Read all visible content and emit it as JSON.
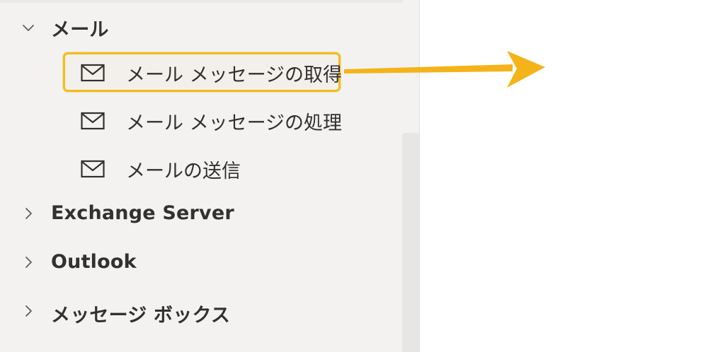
{
  "tree": {
    "group_mail": {
      "label": "メール",
      "expanded": true,
      "icon": "chevron-down-icon"
    },
    "mail_items": [
      {
        "label": "メール メッセージの取得",
        "icon": "mail-icon",
        "highlighted": true
      },
      {
        "label": "メール メッセージの処理",
        "icon": "mail-icon",
        "highlighted": false
      },
      {
        "label": "メールの送信",
        "icon": "mail-icon",
        "highlighted": false
      }
    ],
    "collapsed_groups": [
      {
        "label": "Exchange Server",
        "icon": "chevron-right-icon"
      },
      {
        "label": "Outlook",
        "icon": "chevron-right-icon"
      },
      {
        "label": "メッセージ ボックス",
        "icon": "chevron-right-icon"
      }
    ]
  },
  "colors": {
    "panel_bg": "#f3f2f1",
    "highlight_border": "#f2bd1d",
    "arrow": "#f5b31a",
    "text": "#323130"
  },
  "annotation": {
    "arrow_icon": "arrow-right-icon"
  }
}
